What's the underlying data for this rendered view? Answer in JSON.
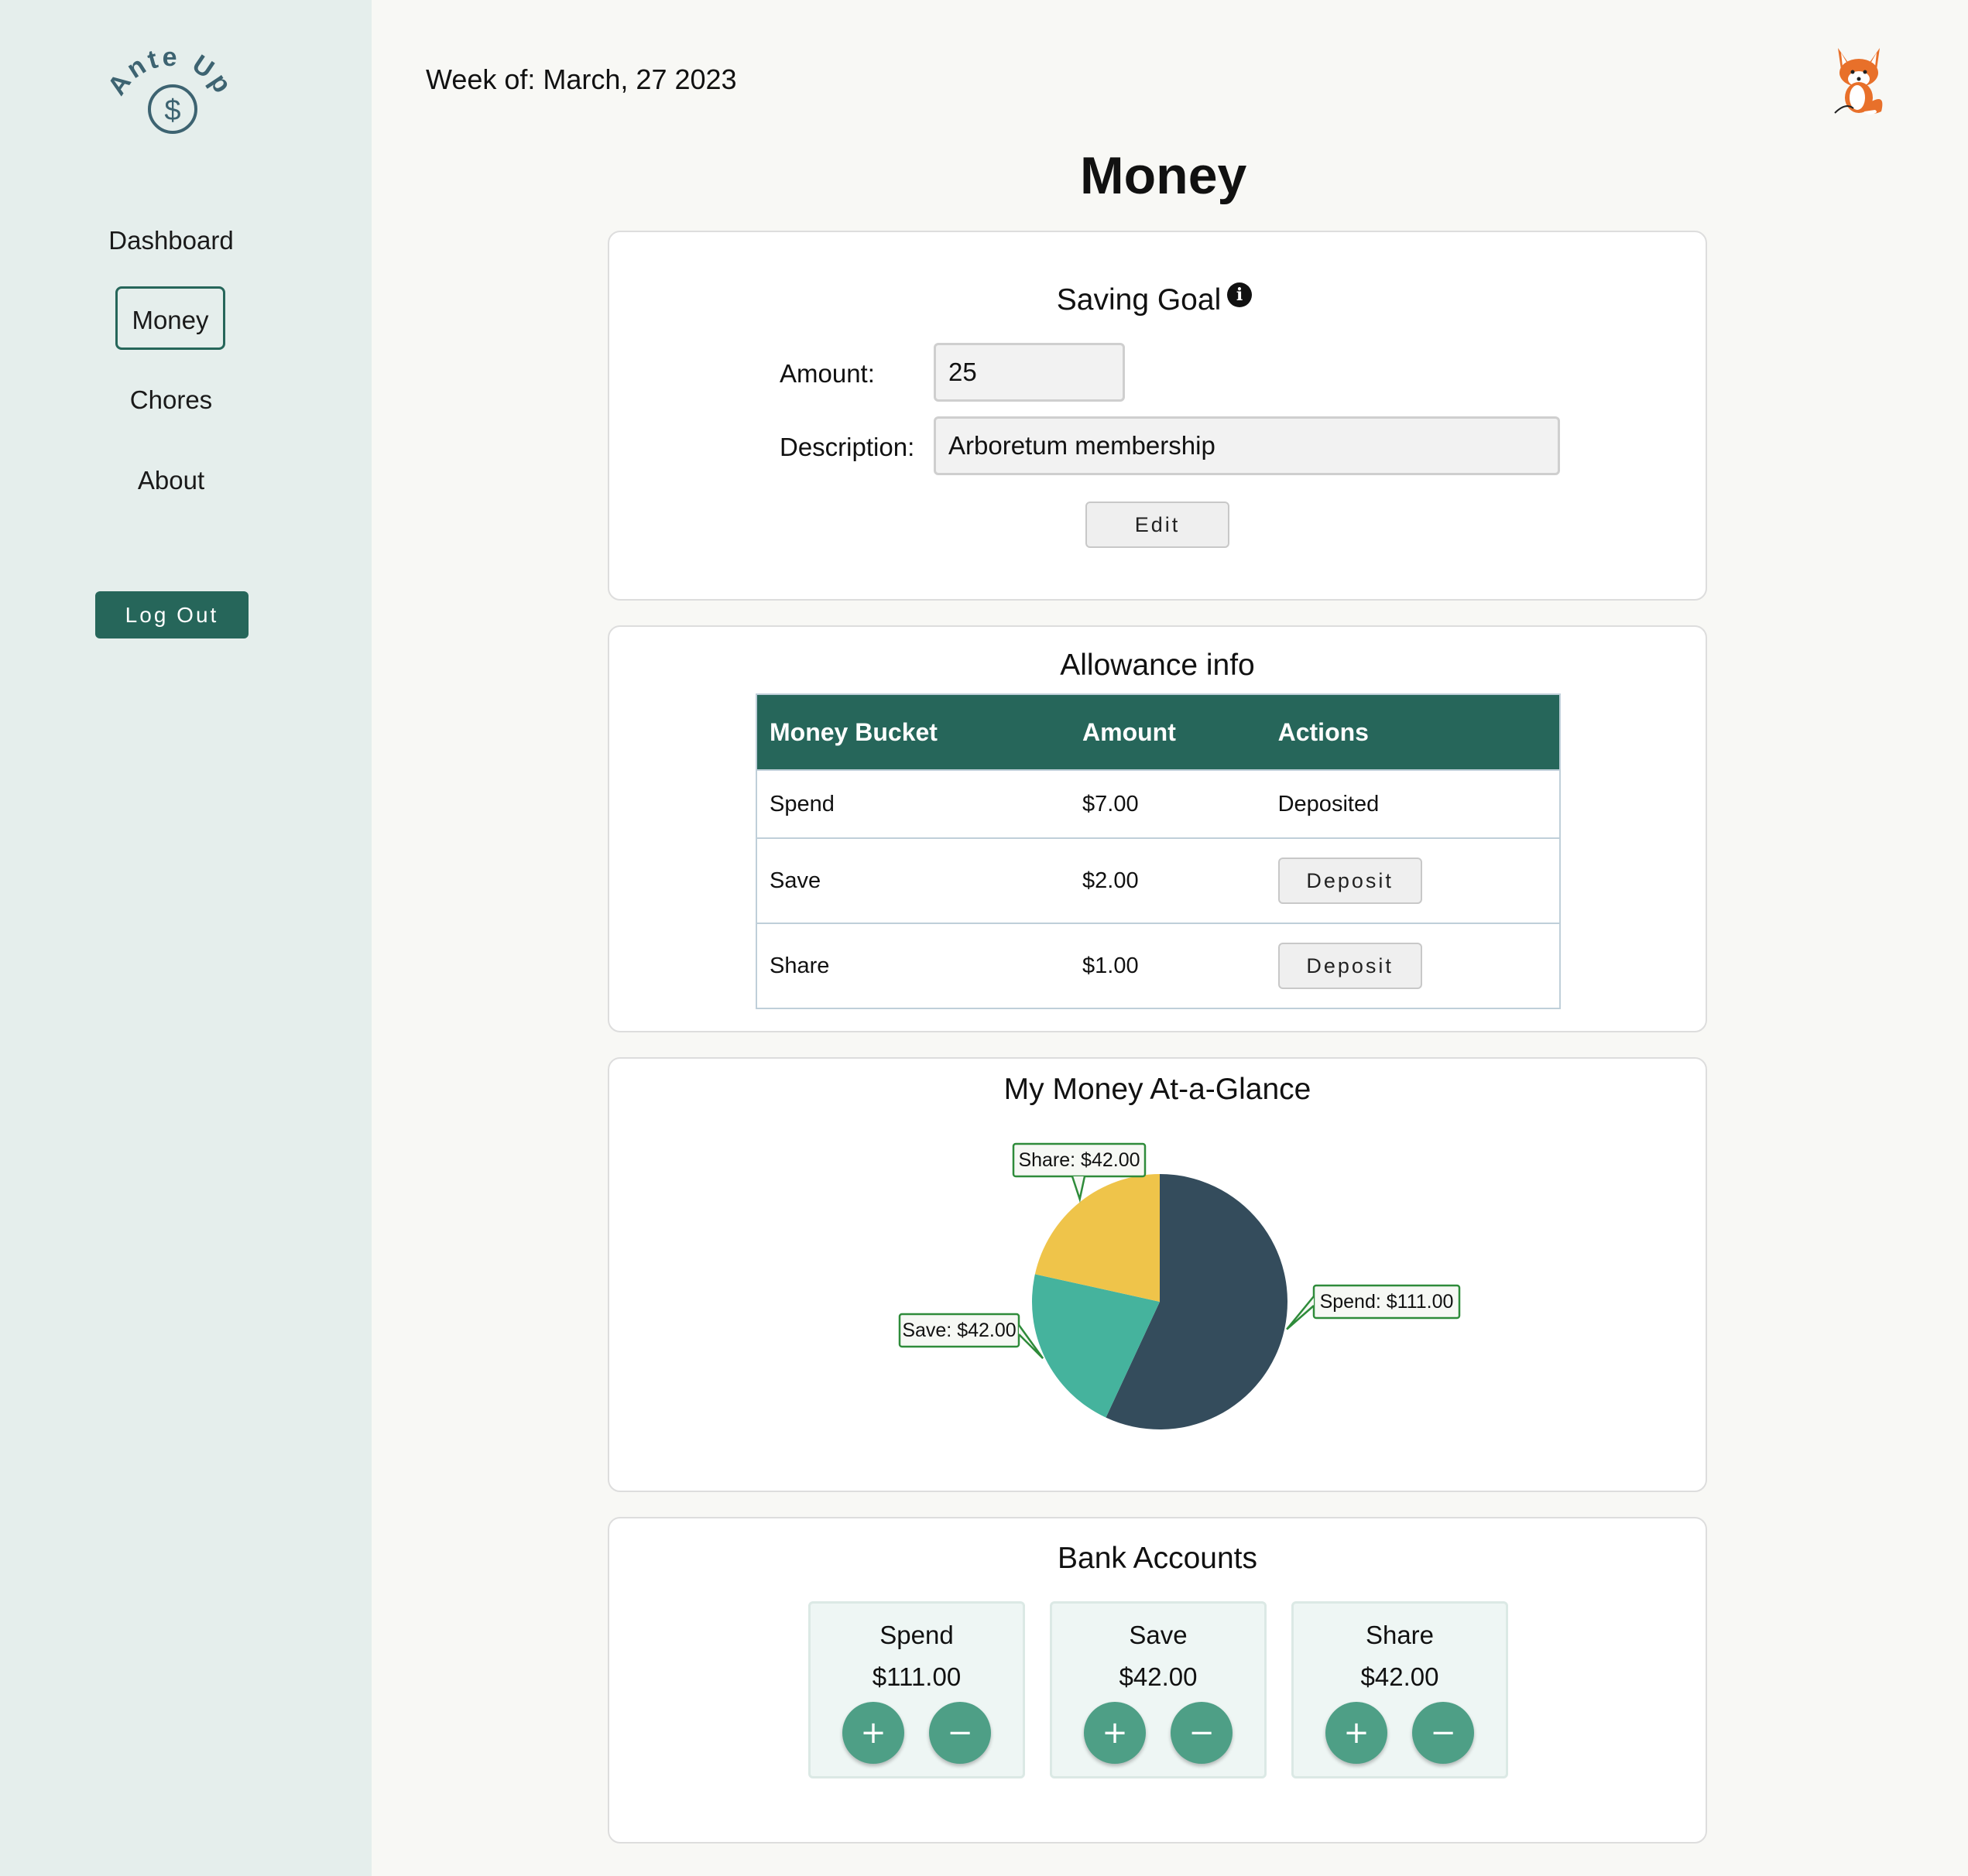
{
  "app": {
    "logo_text": "Ante Up",
    "logo_symbol": "$"
  },
  "sidebar": {
    "items": [
      {
        "label": "Dashboard"
      },
      {
        "label": "Money"
      },
      {
        "label": "Chores"
      },
      {
        "label": "About"
      }
    ],
    "active": "Money",
    "logout_label": "Log Out"
  },
  "header": {
    "week": "Week of: March, 27 2023",
    "avatar_icon": "fox-avatar-icon"
  },
  "page": {
    "title": "Money"
  },
  "saving_goal": {
    "title": "Saving Goal",
    "info_symbol": "i",
    "amount_label": "Amount:",
    "amount_value": "25",
    "description_label": "Description:",
    "description_value": "Arboretum membership",
    "edit_label": "Edit"
  },
  "allowance": {
    "title": "Allowance info",
    "columns": [
      "Money Bucket",
      "Amount",
      "Actions"
    ],
    "rows": [
      {
        "bucket": "Spend",
        "amount": "$7.00",
        "action": "Deposited",
        "action_is_button": false
      },
      {
        "bucket": "Save",
        "amount": "$2.00",
        "action": "Deposit",
        "action_is_button": true
      },
      {
        "bucket": "Share",
        "amount": "$1.00",
        "action": "Deposit",
        "action_is_button": true
      }
    ]
  },
  "glance": {
    "title": "My Money At-a-Glance"
  },
  "chart_data": {
    "type": "pie",
    "slices": [
      {
        "label": "Spend",
        "value": 111.0,
        "display": "Spend: $111.00",
        "color": "#344c5c"
      },
      {
        "label": "Save",
        "value": 42.0,
        "display": "Save: $42.00",
        "color": "#45b39d"
      },
      {
        "label": "Share",
        "value": 42.0,
        "display": "Share: $42.00",
        "color": "#efc44a"
      }
    ],
    "label_border_color": "#2e8b3a"
  },
  "bank": {
    "title": "Bank Accounts",
    "accounts": [
      {
        "name": "Spend",
        "amount": "$111.00"
      },
      {
        "name": "Save",
        "amount": "$42.00"
      },
      {
        "name": "Share",
        "amount": "$42.00"
      }
    ],
    "plus_symbol": "+",
    "minus_symbol": "−"
  },
  "colors": {
    "accent": "#26665a",
    "sidebar_bg": "#e5eeec",
    "button_green": "#4e9f86"
  }
}
